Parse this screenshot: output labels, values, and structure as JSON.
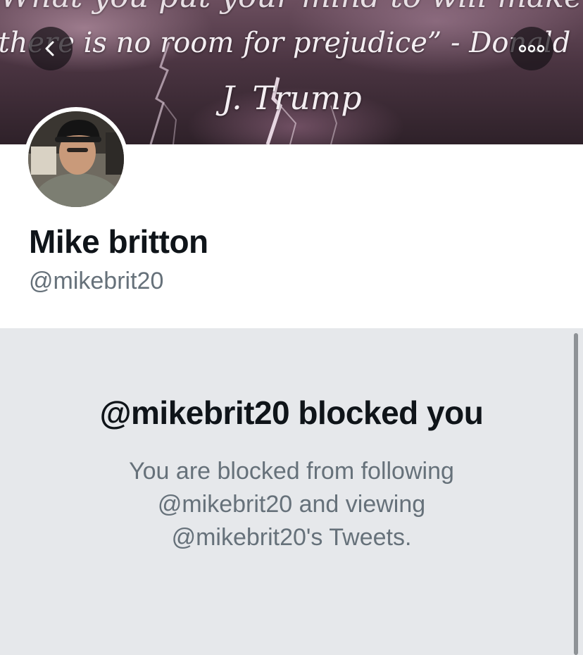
{
  "banner": {
    "quote_line_top": "What you put your mind to will make it,",
    "quote_line_1": "there is no room for prejudice” - Donald",
    "quote_line_2": "J. Trump"
  },
  "nav": {
    "back_icon": "chevron-left-icon",
    "more_icon": "more-horizontal-icon"
  },
  "profile": {
    "display_name": "Mike britton",
    "handle": "@mikebrit20"
  },
  "blocked": {
    "title": "@mikebrit20 blocked you",
    "message": "You are blocked from following @mikebrit20 and viewing @mikebrit20's Tweets."
  },
  "colors": {
    "text_primary": "#0f1419",
    "text_secondary": "#66717a",
    "panel_background": "#e6e8eb",
    "banner_tint": "#4a3441"
  }
}
